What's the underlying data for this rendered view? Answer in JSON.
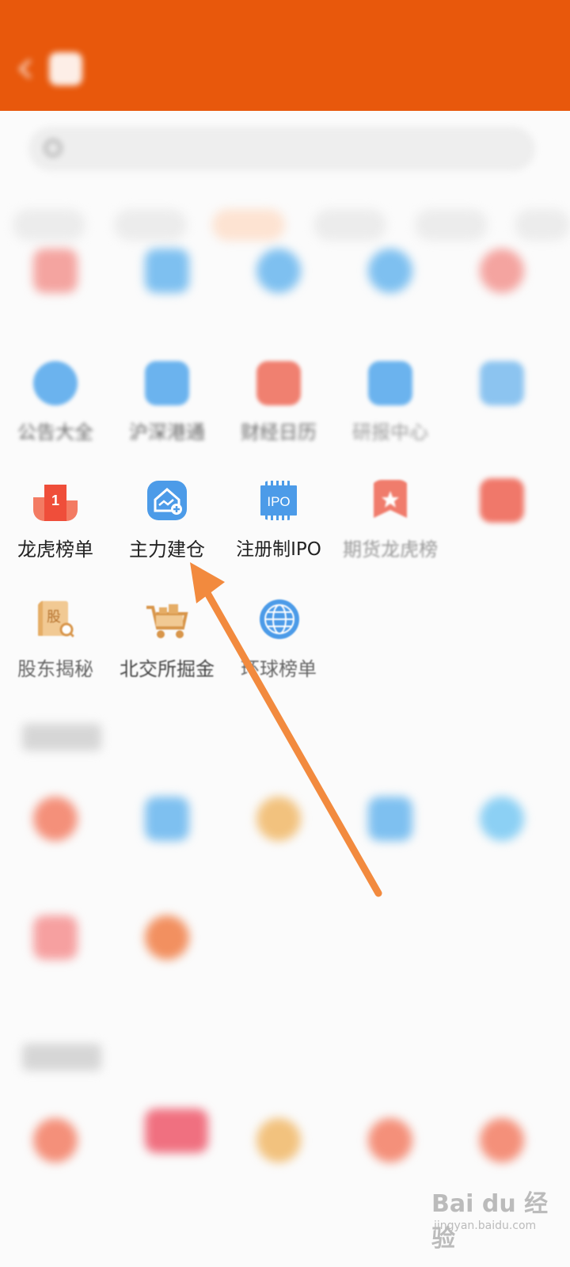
{
  "status": {
    "time": "",
    "right": ""
  },
  "header": {
    "title": "",
    "action": ""
  },
  "search": {
    "placeholder": ""
  },
  "tabs": [
    {
      "label": ""
    },
    {
      "label": ""
    },
    {
      "label": ""
    },
    {
      "label": ""
    },
    {
      "label": ""
    },
    {
      "label": ""
    }
  ],
  "row1": [
    {
      "label": "",
      "icon": "gift-icon",
      "color": "#f4a4a0"
    },
    {
      "label": "",
      "icon": "mail-icon",
      "color": "#7ec0f0"
    },
    {
      "label": "",
      "icon": "chart-icon",
      "color": "#7ec0f0"
    },
    {
      "label": "",
      "icon": "doc-icon",
      "color": "#7ec0f0"
    },
    {
      "label": "",
      "icon": "calendar-icon",
      "color": "#f4a4a0"
    }
  ],
  "row2": [
    {
      "label": "公告大全",
      "icon": "announcement-icon",
      "color": "#6bb3ee"
    },
    {
      "label": "沪深港通",
      "icon": "exchange-icon",
      "color": "#6bb3ee"
    },
    {
      "label": "财经日历",
      "icon": "calendar-icon",
      "color": "#f08070"
    },
    {
      "label": "研报中心",
      "icon": "report-icon",
      "color": "#6bb3ee"
    },
    {
      "label": "",
      "icon": "book-icon",
      "color": "#8cc4f0"
    }
  ],
  "row3": [
    {
      "label": "龙虎榜单",
      "icon": "podium-icon",
      "color": "#f0624a"
    },
    {
      "label": "主力建仓",
      "icon": "house-chart-icon",
      "color": "#4c9be8"
    },
    {
      "label": "注册制IPO",
      "icon": "ipo-chip-icon",
      "color": "#4c9be8"
    },
    {
      "label": "期货龙虎榜",
      "icon": "bookmark-star-icon",
      "color": "#f0624a"
    },
    {
      "label": "",
      "icon": "shield-icon",
      "color": "#f0624a"
    }
  ],
  "row4": [
    {
      "label": "股东揭秘",
      "icon": "book-search-icon",
      "color": "#e8b26e",
      "glyph": "股"
    },
    {
      "label": "北交所掘金",
      "icon": "gold-cart-icon",
      "color": "#e8b26e"
    },
    {
      "label": "环球榜单",
      "icon": "globe-icon",
      "color": "#4c9be8"
    }
  ],
  "section2": {
    "title": ""
  },
  "row5": [
    {
      "label": "",
      "icon": "fire-icon",
      "color": "#f4907a"
    },
    {
      "label": "",
      "icon": "star-icon",
      "color": "#7ec0f0"
    },
    {
      "label": "",
      "icon": "crown-icon",
      "color": "#f2c27e"
    },
    {
      "label": "",
      "icon": "chart-icon",
      "color": "#7ec0f0"
    },
    {
      "label": "",
      "icon": "globe-icon",
      "color": "#8cd0f4"
    }
  ],
  "row6": [
    {
      "label": "",
      "icon": "tag-icon",
      "color": "#f6a0a0"
    },
    {
      "label": "",
      "icon": "coin-icon",
      "color": "#f29060"
    }
  ],
  "section3": {
    "title": ""
  },
  "row7": [
    {
      "label": "",
      "icon": "fire-icon",
      "color": "#f4907a"
    },
    {
      "label": "",
      "icon": "flag-icon",
      "color": "#f07080"
    },
    {
      "label": "",
      "icon": "sun-icon",
      "color": "#f2c27e"
    },
    {
      "label": "",
      "icon": "fire-icon",
      "color": "#f4907a"
    },
    {
      "label": "",
      "icon": "fire-icon",
      "color": "#f4907a"
    }
  ],
  "watermark": {
    "text": "Bai du 经验",
    "sub": "jingyan.baidu.com"
  }
}
